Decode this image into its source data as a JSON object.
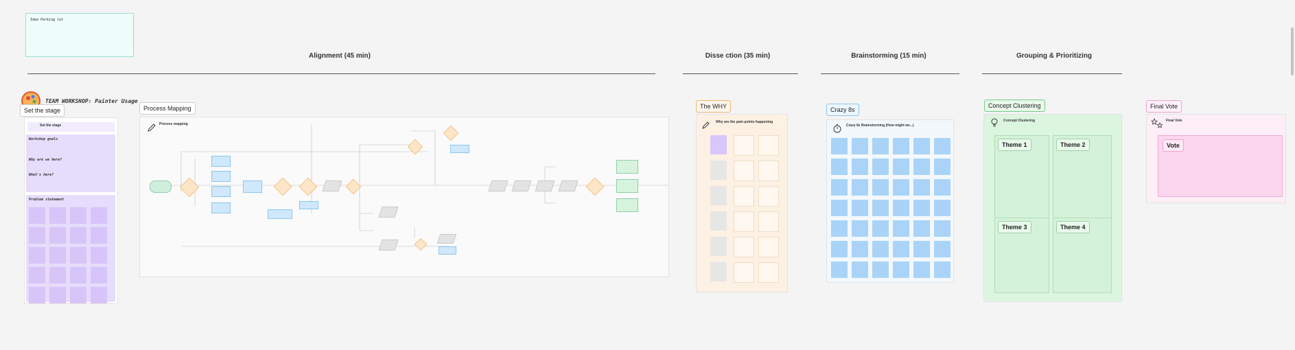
{
  "parking_lot": {
    "label": "Idea Parking lot"
  },
  "sections": {
    "alignment": "Alignment (45 min)",
    "dissection": "Disse ction (35 min)",
    "brainstorming": "Brainstorming (15 min)",
    "grouping": "Grouping & Prioritizing"
  },
  "workshop_title": "TEAM WORKSHOP: Painter Usage",
  "tags": {
    "set_stage": "Set the stage",
    "process_mapping": "Process Mapping",
    "the_why": "The WHY",
    "crazy8s": "Crazy 8s",
    "concept_clustering": "Concept Clustering",
    "final_vote": "Final Vote"
  },
  "set_stage": {
    "header": "Set the stage",
    "goals_title": "Workshop goals",
    "why_title": "Why are we here?",
    "whats_here_title": "What's here?",
    "problem_title": "Problem statement"
  },
  "process_map": {
    "header": "Process mapping"
  },
  "the_why": {
    "header": "Why are the pain points happening"
  },
  "crazy8s": {
    "header": "Crazy 8s Brainstorming (How might we...)"
  },
  "clustering": {
    "header": "Concept Clustering",
    "themes": [
      "Theme 1",
      "Theme 2",
      "Theme 3",
      "Theme 4"
    ]
  },
  "final_vote": {
    "header": "Final Vote",
    "vote_label": "Vote"
  },
  "colors": {
    "purple": "#e6dcfb",
    "green": "#dcf5df",
    "blue": "#a9d4f7",
    "pink": "#fbd6ef",
    "orange": "#fdf1e4"
  }
}
